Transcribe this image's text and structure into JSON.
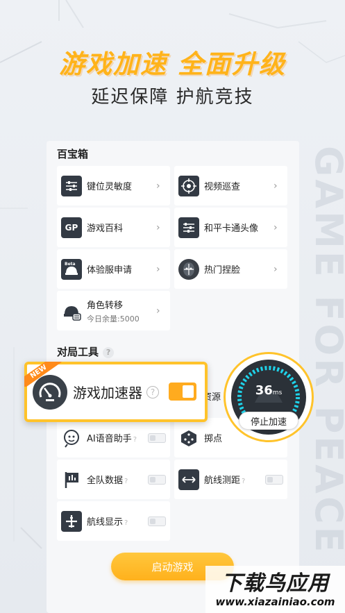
{
  "hero": {
    "title": "游戏加速 全面升级",
    "subtitle": "延迟保障 护航竞技"
  },
  "side_watermark": "GAME FOR PEACE",
  "treasure_box": {
    "title": "百宝箱",
    "items": [
      {
        "label": "键位灵敏度",
        "icon": "sliders-icon"
      },
      {
        "label": "视频巡查",
        "icon": "target-icon"
      },
      {
        "label": "游戏百科",
        "icon": "gp-book-icon"
      },
      {
        "label": "和平卡通头像",
        "icon": "sliders-icon"
      },
      {
        "label": "体验服申请",
        "icon": "beta-helmet-icon"
      },
      {
        "label": "热门捏脸",
        "icon": "face-icon"
      },
      {
        "label": "角色转移",
        "sublabel": "今日余量:5000",
        "icon": "transfer-icon"
      }
    ]
  },
  "match_tools": {
    "title": "对局工具",
    "help": "?",
    "items": [
      {
        "label": "AI语音助手",
        "icon": "ai-voice-icon",
        "help": "?"
      },
      {
        "label": "掷点",
        "icon": "dice-icon",
        "help": ""
      },
      {
        "label": "全队数据",
        "icon": "team-data-icon",
        "help": "?"
      },
      {
        "label": "航线测距",
        "icon": "distance-icon",
        "help": "?"
      },
      {
        "label": "航线显示",
        "icon": "plane-icon",
        "help": "?"
      }
    ],
    "partial_label": "资源"
  },
  "accelerator_popup": {
    "badge": "NEW",
    "label": "游戏加速器",
    "help": "?",
    "enabled": true
  },
  "speed_gauge": {
    "value": "36",
    "unit": "ms",
    "stop_label": "停止加速"
  },
  "launch_button": "启动游戏",
  "site_watermark": {
    "title": "下载鸟应用",
    "url": "www.xiazainiao.com"
  },
  "colors": {
    "accent": "#ffb31a",
    "accent_border": "#ffc32b",
    "icon_dark": "#333a44",
    "panel_bg": "#f6f7f9"
  }
}
